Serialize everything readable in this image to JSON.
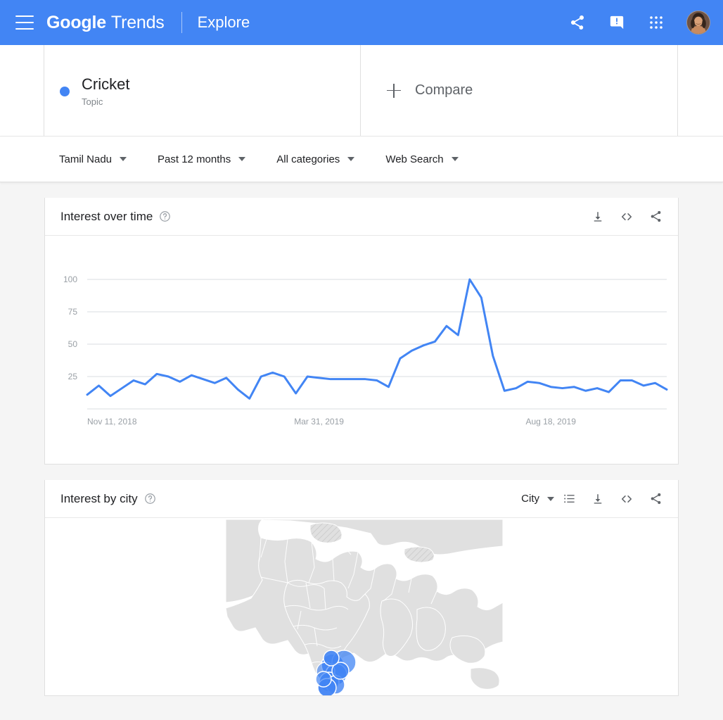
{
  "appbar": {
    "menu_icon": "hamburger-icon",
    "brand_google": "Google",
    "brand_trends": "Trends",
    "section": "Explore",
    "share_icon": "share-icon",
    "feedback_icon": "feedback-icon",
    "apps_icon": "apps-grid-icon",
    "avatar_icon": "user-avatar",
    "background_color": "#4285f4"
  },
  "search_terms": {
    "terms": [
      {
        "label": "Cricket",
        "type": "Topic",
        "color": "#4285f4"
      }
    ],
    "compare_label": "Compare",
    "compare_icon": "plus-icon"
  },
  "filters": [
    {
      "name": "location",
      "label": "Tamil Nadu"
    },
    {
      "name": "time-range",
      "label": "Past 12 months"
    },
    {
      "name": "category",
      "label": "All categories"
    },
    {
      "name": "search-type",
      "label": "Web Search"
    }
  ],
  "interest_over_time": {
    "title": "Interest over time",
    "help_icon": "help-circle-icon",
    "download_icon": "download-icon",
    "embed_icon": "embed-code-icon",
    "share_icon": "share-icon"
  },
  "interest_by_city": {
    "title": "Interest by city",
    "help_icon": "help-circle-icon",
    "region_select": "City",
    "list_icon": "list-view-icon",
    "download_icon": "download-icon",
    "embed_icon": "embed-code-icon",
    "share_icon": "share-icon",
    "map_region": "India and South Asia",
    "marker_color": "#4285f4",
    "land_color": "#e0e0e0"
  },
  "chart_data": {
    "type": "line",
    "title": "Interest over time",
    "xlabel": "",
    "ylabel": "",
    "ylim": [
      0,
      100
    ],
    "yticks": [
      25,
      50,
      75,
      100
    ],
    "grid": true,
    "legend": false,
    "line_color": "#4285f4",
    "xtick_labels": [
      "Nov 11, 2018",
      "Mar 31, 2019",
      "Aug 18, 2019"
    ],
    "xtick_indices": [
      0,
      20,
      40
    ],
    "series": [
      {
        "name": "Cricket",
        "values": [
          11,
          18,
          10,
          16,
          22,
          19,
          27,
          25,
          21,
          26,
          23,
          20,
          24,
          15,
          8,
          25,
          28,
          25,
          12,
          25,
          24,
          23,
          23,
          23,
          23,
          22,
          17,
          39,
          45,
          49,
          52,
          64,
          57,
          100,
          86,
          41,
          14,
          16,
          21,
          20,
          17,
          16,
          17,
          14,
          16,
          13,
          22,
          22,
          18,
          20,
          15
        ]
      }
    ]
  }
}
